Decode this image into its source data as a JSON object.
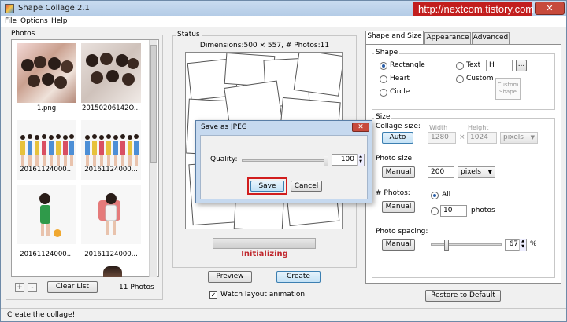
{
  "window": {
    "title": "Shape Collage 2.1",
    "watermark": "http://nextcom.tistory.com",
    "close_glyph": "✕"
  },
  "menu": [
    "File",
    "Options",
    "Help"
  ],
  "photos": {
    "label": "Photos",
    "items": [
      {
        "caption": "1.png"
      },
      {
        "caption": "20150206142O..."
      },
      {
        "caption": "20161124000..."
      },
      {
        "caption": "20161124000..."
      },
      {
        "caption": "20161124000..."
      },
      {
        "caption": "20161124000..."
      }
    ],
    "add_glyph": "+",
    "remove_glyph": "-",
    "clear_label": "Clear List",
    "count_label": "11 Photos"
  },
  "status": {
    "label": "Status",
    "dimensions": "Dimensions:500 × 557, # Photos:11",
    "progress_label": "Initializing",
    "progress_fraction": 0,
    "preview_label": "Preview",
    "create_label": "Create",
    "watch_label": "Watch layout animation",
    "watch_checked": true,
    "check_glyph": "✓"
  },
  "tabs": [
    "Shape and Size",
    "Appearance",
    "Advanced"
  ],
  "shape": {
    "label": "Shape",
    "rectangle": "Rectangle",
    "heart": "Heart",
    "circle": "Circle",
    "text": "Text",
    "text_value": "H",
    "browse": "...",
    "custom": "Custom",
    "custom_shape": "Custom Shape",
    "selected": "rectangle"
  },
  "size": {
    "label": "Size",
    "collage_size": "Collage size:",
    "auto": "Auto",
    "width_label": "Width",
    "height_label": "Height",
    "width": "1280",
    "height": "1024",
    "times": "×",
    "unit": "pixels",
    "photo_size": "Photo size:",
    "manual": "Manual",
    "photo_size_value": "200",
    "photo_unit": "pixels",
    "photos_label": "# Photos:",
    "all": "All",
    "photos_value": "10",
    "photos_suffix": "photos",
    "spacing_label": "Photo spacing:",
    "spacing_value": "67",
    "spacing_unit": "%",
    "spacing_fraction": 0.2
  },
  "restore_label": "Restore to Default",
  "status_bar": "Create the collage!",
  "dialog": {
    "title": "Save as JPEG",
    "quality_label": "Quality:",
    "quality_value": "100",
    "quality_fraction": 1.0,
    "save_label": "Save",
    "cancel_label": "Cancel",
    "close_glyph": "✕"
  },
  "colors": {
    "accent": "#3c7fb1",
    "highlight": "#d11d1d",
    "status_red": "#c0282e"
  }
}
